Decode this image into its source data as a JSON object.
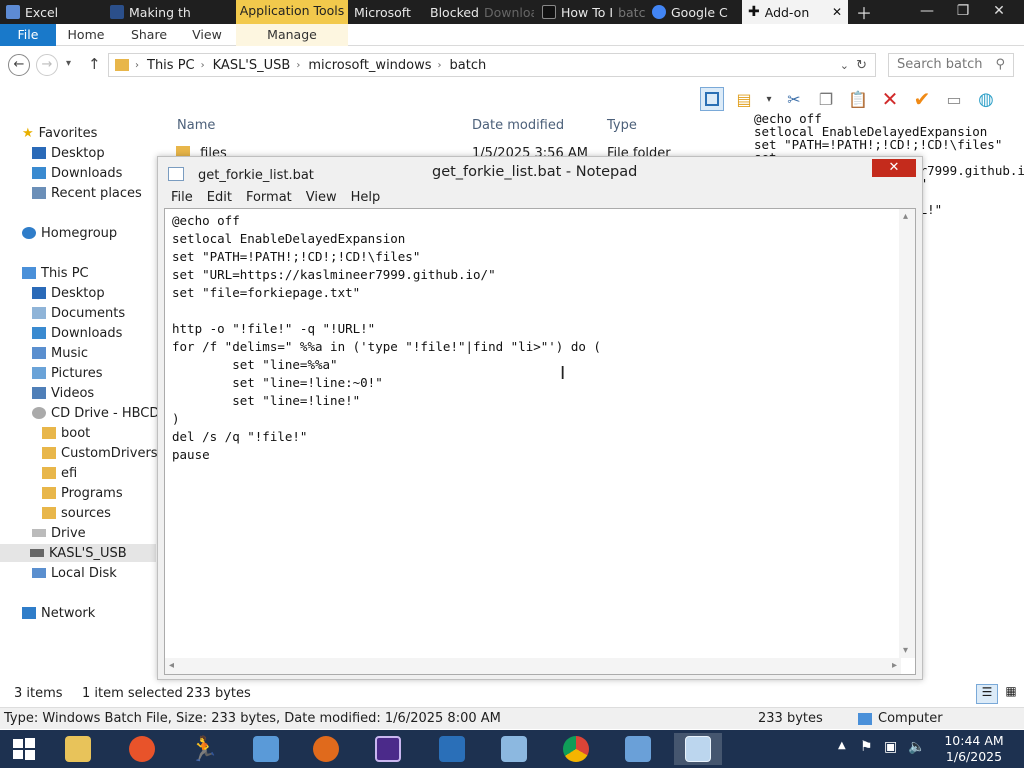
{
  "tabs": [
    {
      "label": "Excel",
      "color": "#5d8bd4"
    },
    {
      "label": "Making th",
      "color": "#2b4f8a"
    },
    {
      "label": "Microsoft",
      "color": "#e66000"
    },
    {
      "label": "Blocked",
      "color": "#333333"
    },
    {
      "label": "Download",
      "color": "#444444"
    },
    {
      "label": "How To I",
      "color": "#111111"
    },
    {
      "label": "batch",
      "color": "#444444"
    },
    {
      "label": "Google C",
      "color": "#4285f4"
    },
    {
      "label": "Add-on",
      "color": "#2b2b2b"
    }
  ],
  "application_tools": "Application Tools",
  "ribbon": {
    "file": "File",
    "home": "Home",
    "share": "Share",
    "view": "View",
    "manage": "Manage"
  },
  "address": {
    "crumbs": [
      "This PC",
      "KASL'S_USB",
      "microsoft_windows",
      "batch"
    ],
    "search_placeholder": "Search batch"
  },
  "columns": {
    "name": "Name",
    "date": "Date modified",
    "type": "Type"
  },
  "files": [
    {
      "name": "files",
      "date": "1/5/2025 3:56 AM",
      "type": "File folder"
    }
  ],
  "nav": {
    "favorites": "Favorites",
    "fav_items": [
      "Desktop",
      "Downloads",
      "Recent places"
    ],
    "homegroup": "Homegroup",
    "this_pc": "This PC",
    "pc_items": [
      "Desktop",
      "Documents",
      "Downloads",
      "Music",
      "Pictures",
      "Videos"
    ],
    "cd_drive": "CD Drive - HBCD_",
    "cd_items": [
      "boot",
      "CustomDrivers",
      "efi",
      "Programs",
      "sources"
    ],
    "drive": "Drive",
    "usb": "KASL'S_USB",
    "local": "Local Disk",
    "network": "Network"
  },
  "preview_text": "@echo off\nsetlocal EnableDelayedExpansion\nset \"PATH=!PATH!;!CD!;!CD!\\files\"\nset\n\"URL=https://kaslmineer7999.github.io/\"\n                  .txt\"\n\n                  \"!URL!\"\n                  li>\"",
  "notepad": {
    "file_name": "get_forkie_list.bat",
    "caption": "get_forkie_list.bat - Notepad",
    "close": "✕",
    "menu": [
      "File",
      "Edit",
      "Format",
      "View",
      "Help"
    ],
    "content": "@echo off\nsetlocal EnableDelayedExpansion\nset \"PATH=!PATH!;!CD!;!CD!\\files\"\nset \"URL=https://kaslmineer7999.github.io/\"\nset \"file=forkiepage.txt\"\n\nhttp -o \"!file!\" -q \"!URL!\"\nfor /f \"delims=\" %%a in ('type \"!file!\"|find \"li>\"') do (\n        set \"line=%%a\"\n        set \"line=!line:~0!\"\n        set \"line=!line!\"\n)\ndel /s /q \"!file!\"\npause"
  },
  "status": {
    "items": "3 items",
    "selected": "1 item selected",
    "size": "233 bytes",
    "details": "Type: Windows Batch File, Size: 233 bytes, Date modified: 1/6/2025 8:00 AM",
    "size2": "233 bytes",
    "computer": "Computer"
  },
  "clock": {
    "time": "10:44 AM",
    "date": "1/6/2025"
  },
  "colors": {
    "accent": "#1979ca",
    "taskbar": "#1d3150",
    "close": "#c42b1c"
  }
}
